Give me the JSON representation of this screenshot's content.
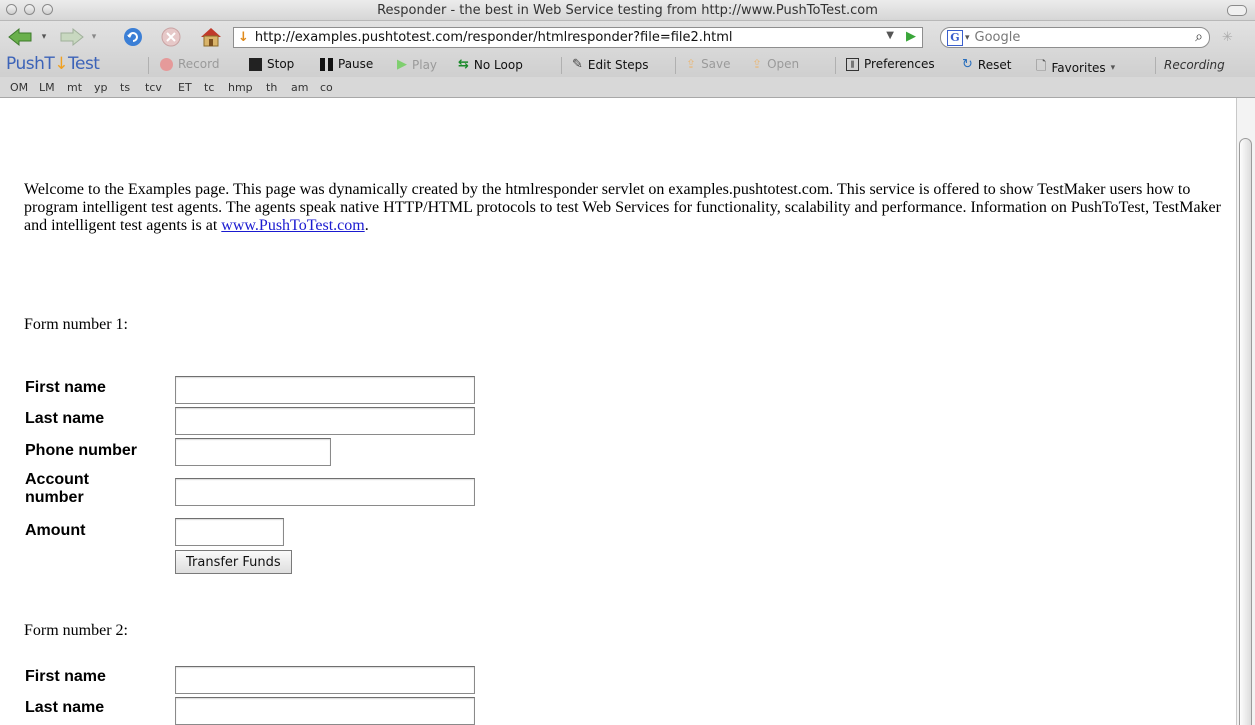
{
  "window": {
    "title": "Responder - the best in Web Service testing from http://www.PushToTest.com"
  },
  "nav": {
    "url": "http://examples.pushtotest.com/responder/htmlresponder?file=file2.html",
    "search_placeholder": "Google"
  },
  "toolbar": {
    "brand_push": "PushT",
    "brand_to": "↓",
    "brand_test": "Test",
    "record": "Record",
    "stop": "Stop",
    "pause": "Pause",
    "play": "Play",
    "noloop": "No Loop",
    "edit_steps": "Edit Steps",
    "save": "Save",
    "open": "Open",
    "preferences": "Preferences",
    "reset": "Reset",
    "favorites": "Favorites",
    "status": "Recording"
  },
  "bookmarks": [
    "OM",
    "LM",
    "mt",
    "yp",
    "ts",
    "tcv",
    "ET",
    "tc",
    "hmp",
    "th",
    "am",
    "co"
  ],
  "page": {
    "intro": "Welcome to the Examples page. This page was dynamically created by the htmlresponder servlet on examples.pushtotest.com. This service is offered to show TestMaker users how to program intelligent test agents. The agents speak native HTTP/HTML protocols to test Web Services for functionality, scalability and performance. Information on PushToTest, TestMaker and intelligent test agents is at ",
    "intro_link": "www.PushToTest.com",
    "intro_end": ".",
    "form1": {
      "header": "Form number 1:",
      "first_name": "First name",
      "last_name": "Last name",
      "phone": "Phone number",
      "account_line1": "Account",
      "account_line2": "number",
      "amount": "Amount",
      "submit": "Transfer Funds"
    },
    "form2": {
      "header": "Form number 2:",
      "first_name": "First name",
      "last_name": "Last name"
    }
  }
}
